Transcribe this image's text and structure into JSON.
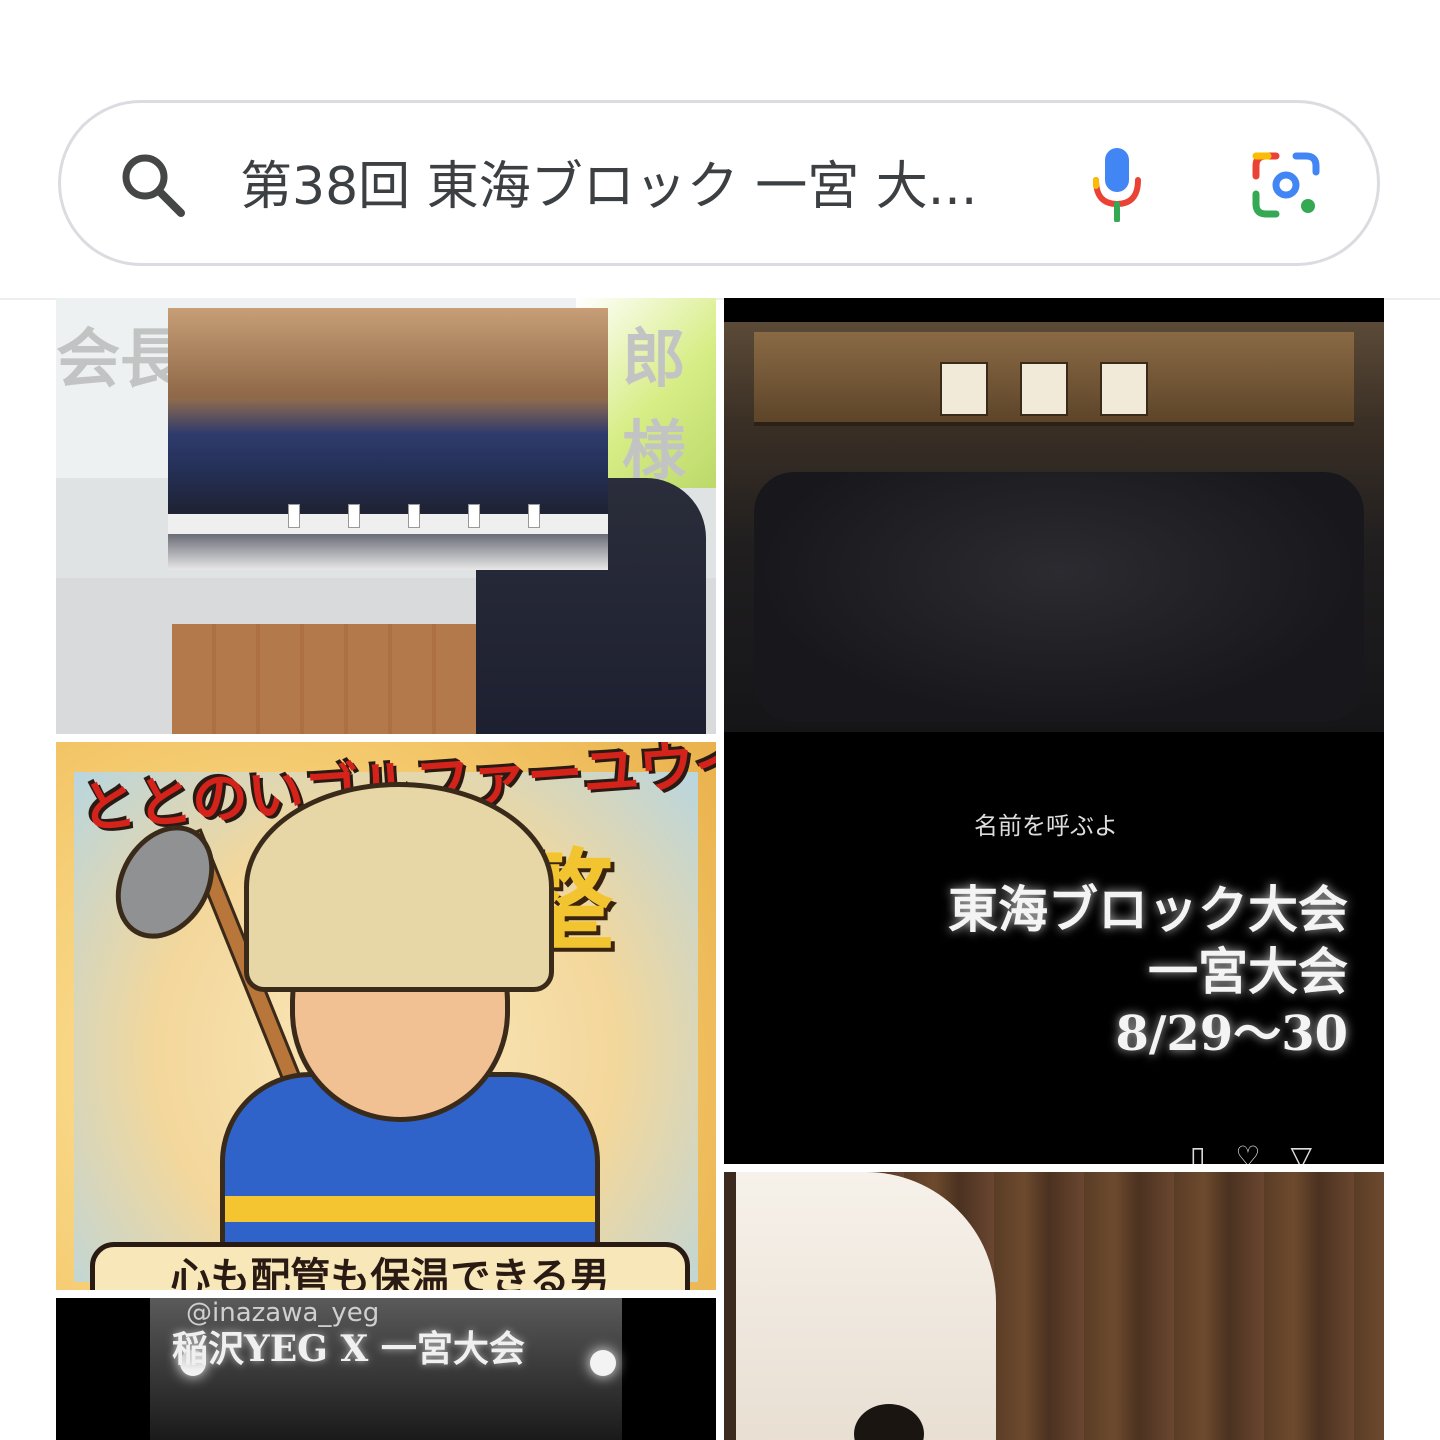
{
  "search": {
    "query": "第38回 東海ブロック 一宮 大...",
    "search_icon": "search-icon",
    "mic_icon": "mic-icon",
    "lens_icon": "google-lens-icon",
    "colors": {
      "border": "#dadce0",
      "text": "#3c4043",
      "google_blue": "#4285f4",
      "google_red": "#ea4335",
      "google_yellow": "#fbbc04",
      "google_green": "#34a853"
    }
  },
  "results": {
    "tile1": {
      "ghost_left": "会長",
      "ghost_right": "郎 様"
    },
    "tile2": {
      "small_text": "名前を呼ぶよ",
      "line1": "東海ブロック大会",
      "line2": "一宮大会",
      "line3": "8/29〜30"
    },
    "tile3": {
      "banner": "ととのいゴルファーユウイチ",
      "kanji": "整",
      "caption": "心も配管も保温できる男"
    },
    "tile4": {
      "handle": "@inazawa_yeg",
      "title": "稲沢YEG X 一宮大会"
    }
  }
}
